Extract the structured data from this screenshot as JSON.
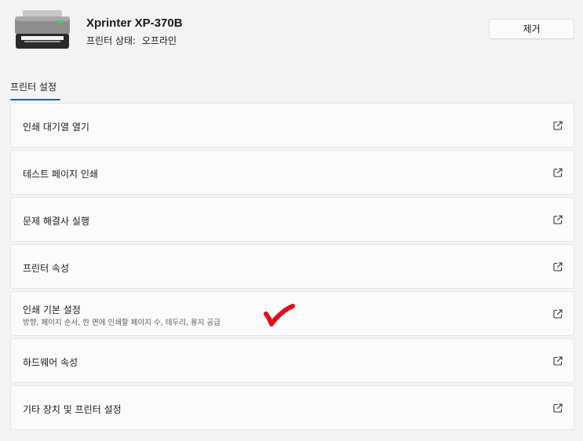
{
  "header": {
    "printer_name": "Xprinter XP-370B",
    "status_label": "프린터 상태:",
    "status_value": "오프라인",
    "remove_button_label": "제거",
    "printer_icon": "printer-icon"
  },
  "tab": {
    "label": "프린터 설정"
  },
  "settings": [
    {
      "label": "인쇄 대기열 열기",
      "icon": "external-link-icon"
    },
    {
      "label": "테스트 페이지 인쇄",
      "icon": "external-link-icon"
    },
    {
      "label": "문제 해결사 실행",
      "icon": "external-link-icon"
    },
    {
      "label": "프린터 속성",
      "icon": "external-link-icon"
    },
    {
      "label": "인쇄 기본 설정",
      "description": "방향, 페이지 순서, 한 면에 인쇄할 페이지 수, 테두리, 용지 공급",
      "icon": "external-link-icon"
    },
    {
      "label": "하드웨어 속성",
      "icon": "external-link-icon"
    },
    {
      "label": "기타 장치 및 프린터 설정",
      "icon": "external-link-icon"
    }
  ],
  "annotation": {
    "icon": "red-checkmark-icon",
    "color": "#e0101a"
  },
  "colors": {
    "accent": "#0067c0",
    "background": "#f3f3f3",
    "card": "#fbfbfb"
  }
}
